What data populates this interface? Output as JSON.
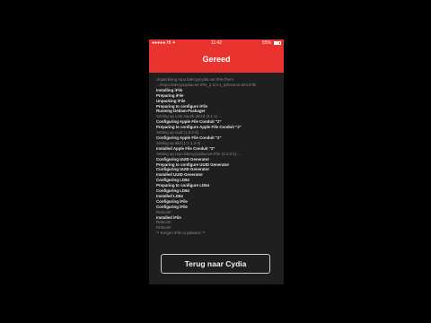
{
  "status_bar": {
    "carrier": "●●●●● Hi ✈",
    "time": "11:42",
    "battery": "55%"
  },
  "nav": {
    "title": "Gereed"
  },
  "console": {
    "lines": [
      {
        "text": "Unpackning repo.bitecyycydia.net iFile them",
        "style": "dim"
      },
      {
        "text": "...//repo.bitecyycydia.net iFile_2.2.0-1_iphoneos-arm.iFile",
        "style": "dim"
      },
      {
        "text": "Installing iFile",
        "style": "bold"
      },
      {
        "text": "Preparing iFile",
        "style": "bold"
      },
      {
        "text": "Unpacking iFile",
        "style": "bold"
      },
      {
        "text": "Preparing to configure iFile",
        "style": "bold"
      },
      {
        "text": "Running Debian-Packager",
        "style": "bold"
      },
      {
        "text": "Setting up com.saurik.afc2d (2.1.1) ...",
        "style": "dim"
      },
      {
        "text": "Configuring Apple File Conduit \"2\"",
        "style": "bold"
      },
      {
        "text": "Preparing to configure Apple File Conduit \"2\"",
        "style": "bold"
      },
      {
        "text": "Setting up uuid (1.6.2-6) ...",
        "style": "dim"
      },
      {
        "text": "Configuring Apple File Conduit \"2\"",
        "style": "bold"
      },
      {
        "text": "Setting up ldid (1:1.1.2-3) ...",
        "style": "dim"
      },
      {
        "text": "Installed Apple File Conduit \"2\"",
        "style": "bold"
      },
      {
        "text": "Setting up repo.bitecyycydia.net iFile (2.2.0-1) ...",
        "style": "dim"
      },
      {
        "text": "Configuring UUID Generator",
        "style": "bold"
      },
      {
        "text": "Preparing to configure UUID Generator",
        "style": "bold"
      },
      {
        "text": "Configuring UUID Generator",
        "style": "bold"
      },
      {
        "text": "Installed UUID Generator",
        "style": "bold"
      },
      {
        "text": "Configuring LD64",
        "style": "bold"
      },
      {
        "text": "Preparing to configure LD64",
        "style": "bold"
      },
      {
        "text": "Configuring LD64",
        "style": "bold"
      },
      {
        "text": "Installed LD64",
        "style": "bold"
      },
      {
        "text": "Configuring iFile",
        "style": "bold"
      },
      {
        "text": "Configuring iFile",
        "style": "bold"
      },
      {
        "text": "Reboot!!",
        "style": "dim"
      },
      {
        "text": "Installed iFile",
        "style": "bold"
      },
      {
        "text": "Reboot!!",
        "style": "dim"
      },
      {
        "text": "Reboot!!",
        "style": "dim"
      },
      {
        "text": "** Kergen iFile to jailwenz **",
        "style": "dim"
      }
    ]
  },
  "return_button": {
    "label": "Terug naar Cydia"
  }
}
